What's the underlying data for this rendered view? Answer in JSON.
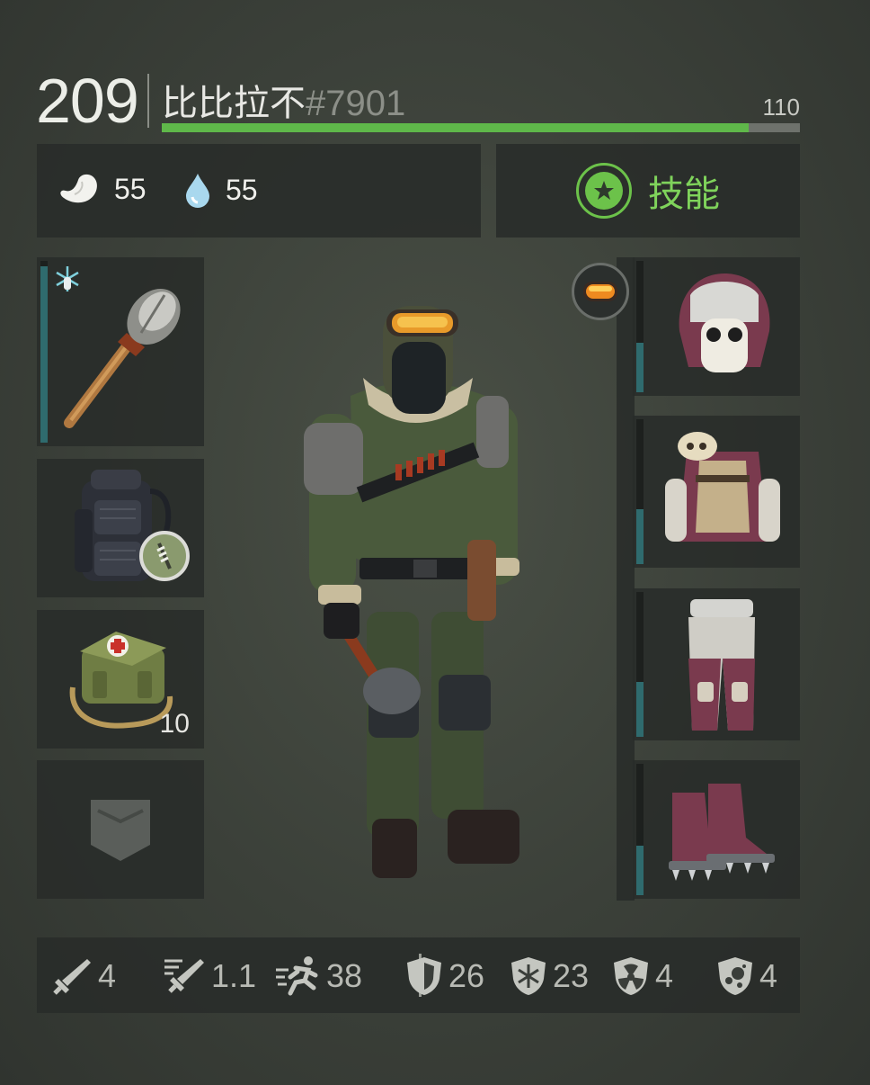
{
  "header": {
    "level": "209",
    "player_name": "比比拉不",
    "player_tag": "#7901",
    "xp_value": "110",
    "xp_fraction": 0.92
  },
  "needs": {
    "hunger": {
      "icon": "stomach-icon",
      "value": "55"
    },
    "thirst": {
      "icon": "water-drop-icon",
      "value": "55"
    }
  },
  "skills_button": {
    "label": "技能",
    "icon": "star-icon"
  },
  "left_slots": [
    {
      "name": "weapon-slot",
      "item": "spiked-club",
      "durability": 0.97,
      "badge": "frost-icon"
    },
    {
      "name": "backpack-slot",
      "item": "tactical-backpack"
    },
    {
      "name": "consumable-slot",
      "item": "first-aid-kit",
      "count": "10"
    },
    {
      "name": "pocket-slot",
      "item": "empty-pocket-icon"
    }
  ],
  "right_slots": [
    {
      "name": "head-slot",
      "item": "fur-hat-with-mask",
      "durability": 0.38,
      "accessory": "goggles-icon"
    },
    {
      "name": "chest-slot",
      "item": "bone-fur-armor",
      "durability": 0.38
    },
    {
      "name": "legs-slot",
      "item": "fur-pants",
      "durability": 0.38
    },
    {
      "name": "feet-slot",
      "item": "spiked-fur-boots",
      "durability": 0.38
    }
  ],
  "stats": [
    {
      "icon": "sword-icon",
      "value": "4"
    },
    {
      "icon": "attack-speed-icon",
      "value": "1.1"
    },
    {
      "icon": "run-speed-icon",
      "value": "38"
    },
    {
      "icon": "shield-icon",
      "value": "26"
    },
    {
      "icon": "cold-resist-icon",
      "value": "23"
    },
    {
      "icon": "radiation-resist-icon",
      "value": "4"
    },
    {
      "icon": "toxic-resist-icon",
      "value": "4"
    }
  ],
  "colors": {
    "xp_green": "#5fb84a",
    "skill_green": "#6cc24a",
    "durability_teal": "#2f6b6e"
  }
}
